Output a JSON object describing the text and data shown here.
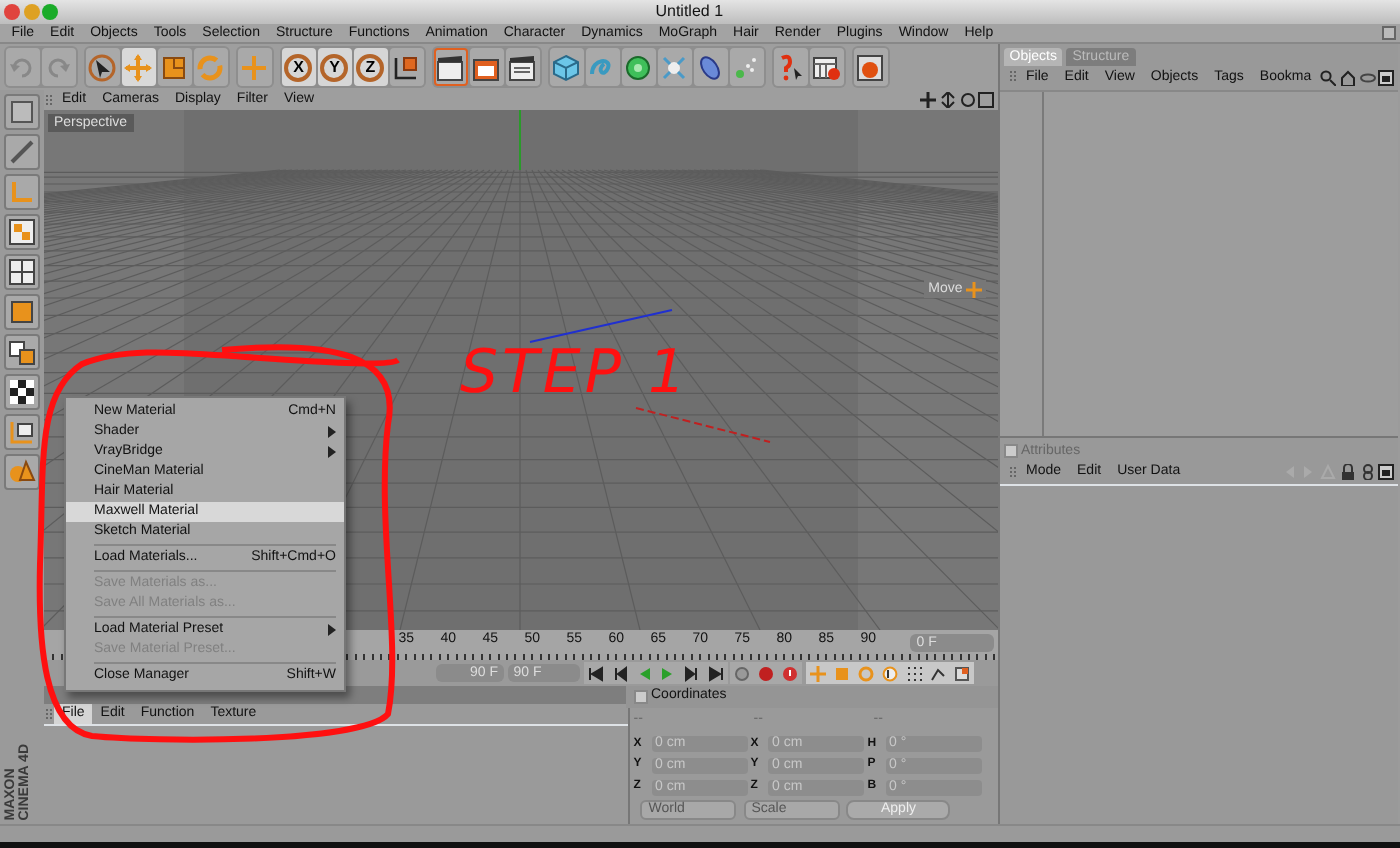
{
  "window": {
    "title": "Untitled 1"
  },
  "menubar": [
    "File",
    "Edit",
    "Objects",
    "Tools",
    "Selection",
    "Structure",
    "Functions",
    "Animation",
    "Character",
    "Dynamics",
    "MoGraph",
    "Hair",
    "Render",
    "Plugins",
    "Window",
    "Help"
  ],
  "toolbar": {
    "axis_buttons": [
      "X",
      "Y",
      "Z"
    ]
  },
  "viewport": {
    "menu": [
      "Edit",
      "Cameras",
      "Display",
      "Filter",
      "View"
    ],
    "label": "Perspective",
    "hud_label": "Move"
  },
  "annotation": {
    "text": "STEP 1"
  },
  "context_menu": {
    "items": [
      {
        "kind": "item",
        "label": "New Material",
        "shortcut": "Cmd+N",
        "submenu": false,
        "disabled": false,
        "selected": false
      },
      {
        "kind": "item",
        "label": "Shader",
        "submenu": true,
        "disabled": false,
        "selected": false
      },
      {
        "kind": "item",
        "label": "VrayBridge",
        "submenu": true,
        "disabled": false,
        "selected": false
      },
      {
        "kind": "item",
        "label": "CineMan Material",
        "submenu": false,
        "disabled": false,
        "selected": false
      },
      {
        "kind": "item",
        "label": "Hair Material",
        "submenu": false,
        "disabled": false,
        "selected": false
      },
      {
        "kind": "item",
        "label": "Maxwell Material",
        "submenu": false,
        "disabled": false,
        "selected": true
      },
      {
        "kind": "item",
        "label": "Sketch Material",
        "submenu": false,
        "disabled": false,
        "selected": false
      },
      {
        "kind": "separator"
      },
      {
        "kind": "item",
        "label": "Load Materials...",
        "shortcut": "Shift+Cmd+O",
        "submenu": false,
        "disabled": false,
        "selected": false
      },
      {
        "kind": "separator"
      },
      {
        "kind": "item",
        "label": "Save Materials as...",
        "submenu": false,
        "disabled": true,
        "selected": false
      },
      {
        "kind": "item",
        "label": "Save All Materials as...",
        "submenu": false,
        "disabled": true,
        "selected": false
      },
      {
        "kind": "separator"
      },
      {
        "kind": "item",
        "label": "Load Material Preset",
        "submenu": true,
        "disabled": false,
        "selected": false
      },
      {
        "kind": "item",
        "label": "Save Material Preset...",
        "submenu": false,
        "disabled": true,
        "selected": false
      },
      {
        "kind": "separator"
      },
      {
        "kind": "item",
        "label": "Close Manager",
        "shortcut": "Shift+W",
        "submenu": false,
        "disabled": false,
        "selected": false
      }
    ]
  },
  "timeline": {
    "ruler_labels": [
      "35",
      "40",
      "45",
      "50",
      "55",
      "60",
      "65",
      "70",
      "75",
      "80",
      "85",
      "90"
    ],
    "current_frame": "0 F",
    "start_field": "90 F",
    "end_field": "90 F"
  },
  "material_manager": {
    "menu": [
      {
        "label": "File",
        "selected": true
      },
      {
        "label": "Edit",
        "selected": false
      },
      {
        "label": "Function",
        "selected": false
      },
      {
        "label": "Texture",
        "selected": false
      }
    ]
  },
  "coordinates": {
    "title": "Coordinates",
    "headers": [
      "--",
      "--",
      "--"
    ],
    "rows": [
      {
        "label_1": "X",
        "value_1": "0 cm",
        "label_2": "X",
        "value_2": "0 cm",
        "label_3": "H",
        "value_3": "0 °"
      },
      {
        "label_1": "Y",
        "value_1": "0 cm",
        "label_2": "Y",
        "value_2": "0 cm",
        "label_3": "P",
        "value_3": "0 °"
      },
      {
        "label_1": "Z",
        "value_1": "0 cm",
        "label_2": "Z",
        "value_2": "0 cm",
        "label_3": "B",
        "value_3": "0 °"
      }
    ],
    "position_mode": "World",
    "size_mode": "Scale",
    "apply_button": "Apply"
  },
  "object_manager": {
    "tabs": [
      {
        "label": "Objects",
        "selected": true
      },
      {
        "label": "Structure",
        "selected": false
      }
    ],
    "menu": [
      "File",
      "Edit",
      "View",
      "Objects",
      "Tags",
      "Bookma"
    ]
  },
  "attributes": {
    "title": "Attributes",
    "menu": [
      "Mode",
      "Edit",
      "User Data"
    ]
  },
  "logo": {
    "lines": [
      "MAXON",
      "CINEMA 4D"
    ]
  }
}
